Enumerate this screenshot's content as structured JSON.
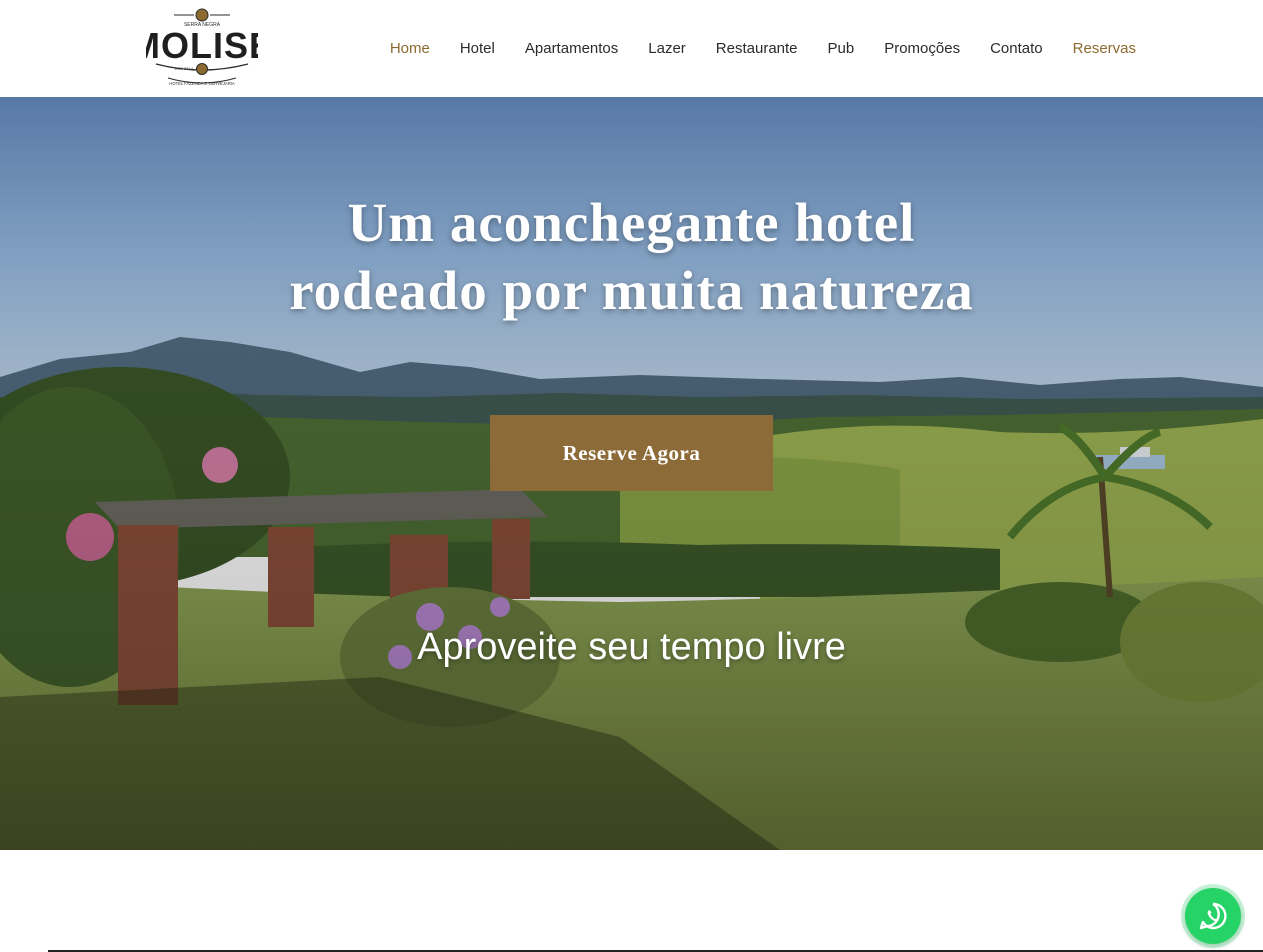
{
  "brand": {
    "name": "MOLISE",
    "top_text": "SERRA NEGRA",
    "est_text": "EST 2014",
    "bottom_text": "HOTEL FAZENDA E CERVEJARIA"
  },
  "nav": {
    "items": [
      {
        "label": "Home",
        "active": true
      },
      {
        "label": "Hotel"
      },
      {
        "label": "Apartamentos"
      },
      {
        "label": "Lazer"
      },
      {
        "label": "Restaurante"
      },
      {
        "label": "Pub"
      },
      {
        "label": "Promoções"
      },
      {
        "label": "Contato"
      },
      {
        "label": "Reservas",
        "highlight": true
      }
    ]
  },
  "hero": {
    "title_line1": "Um aconchegante hotel",
    "title_line2": "rodeado por muita natureza",
    "cta_label": "Reserve Agora",
    "subtitle": "Aproveite seu tempo livre"
  },
  "colors": {
    "accent": "#8c6b30",
    "button": "#8c6b38",
    "whatsapp": "#25d366"
  },
  "floating": {
    "whatsapp_icon": "whatsapp-icon"
  }
}
